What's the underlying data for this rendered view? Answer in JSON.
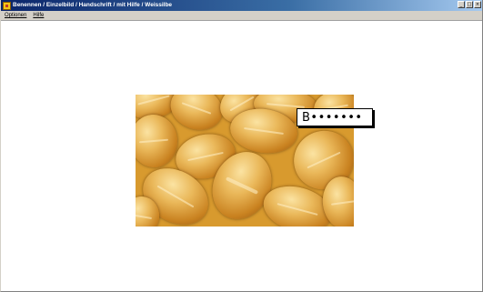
{
  "window": {
    "title": "Benennen / Einzelbild / Handschrift / mit Hilfe / Weissilbe",
    "controls": {
      "minimize_label": "_",
      "maximize_label": "□",
      "close_label": "×"
    }
  },
  "menubar": {
    "items": [
      {
        "label": "Optionen"
      },
      {
        "label": "Hilfe"
      }
    ]
  },
  "exercise": {
    "image_name": "bread-rolls-photo",
    "word_hint": "B•••••••"
  },
  "colors": {
    "titlebar_start": "#0a246a",
    "titlebar_end": "#a6caf0",
    "menubar": "#d4d0c8",
    "background": "#ffffff"
  }
}
